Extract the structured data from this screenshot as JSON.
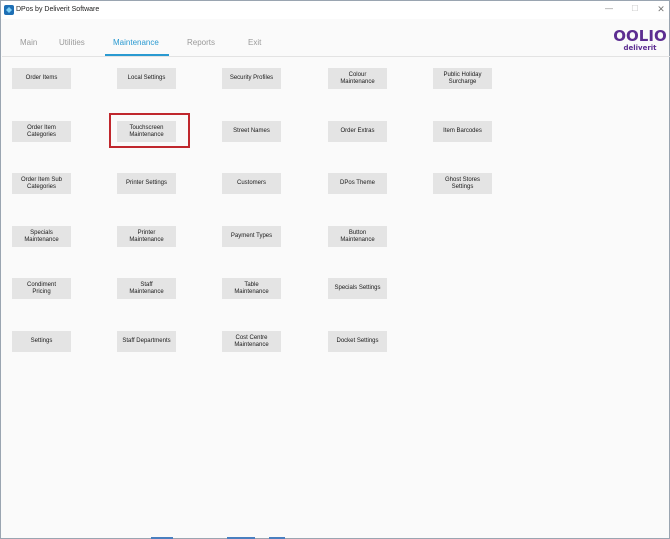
{
  "window": {
    "title": "DPos by Deliverit Software",
    "min_glyph": "—",
    "max_glyph": "☐",
    "close_glyph": "✕"
  },
  "tabs": [
    {
      "label": "Main"
    },
    {
      "label": "Utilities"
    },
    {
      "label": "Maintenance",
      "active": true
    },
    {
      "label": "Reports"
    },
    {
      "label": "Exit"
    }
  ],
  "logo": {
    "word": "OOLIO",
    "sub": "deliverit",
    "color": "#5c2d91"
  },
  "accent_color": "#2a9ad1",
  "highlight_color": "#c0272d",
  "buttons": {
    "order_items": [
      "Order Items"
    ],
    "local_settings": [
      "Local Settings"
    ],
    "security_profiles": [
      "Security Profiles"
    ],
    "colour_maintenance": [
      "Colour",
      "Maintenance"
    ],
    "public_holiday_surcharge": [
      "Public Holiday",
      "Surcharge"
    ],
    "order_item_categories": [
      "Order Item",
      "Categories"
    ],
    "touchscreen_maintenance": [
      "Touchscreen",
      "Maintenance"
    ],
    "street_names": [
      "Street Names"
    ],
    "order_extras": [
      "Order Extras"
    ],
    "item_barcodes": [
      "Item Barcodes"
    ],
    "order_item_sub_categories": [
      "Order Item Sub",
      "Categories"
    ],
    "printer_settings": [
      "Printer Settings"
    ],
    "customers": [
      "Customers"
    ],
    "dpos_theme": [
      "DPos Theme"
    ],
    "ghost_stores_settings": [
      "Ghost Stores",
      "Settings"
    ],
    "specials_maintenance": [
      "Specials",
      "Maintenance"
    ],
    "printer_maintenance": [
      "Printer",
      "Maintenance"
    ],
    "payment_types": [
      "Payment Types"
    ],
    "button_maintenance": [
      "Button",
      "Maintenance"
    ],
    "condiment_pricing": [
      "Condiment",
      "Pricing"
    ],
    "staff_maintenance": [
      "Staff",
      "Maintenance"
    ],
    "table_maintenance": [
      "Table",
      "Maintenance"
    ],
    "specials_settings": [
      "Specials Settings"
    ],
    "settings": [
      "Settings"
    ],
    "staff_departments": [
      "Staff Departments"
    ],
    "cost_centre_maintenance": [
      "Cost Centre",
      "Maintenance"
    ],
    "docket_settings": [
      "Docket Settings"
    ]
  }
}
